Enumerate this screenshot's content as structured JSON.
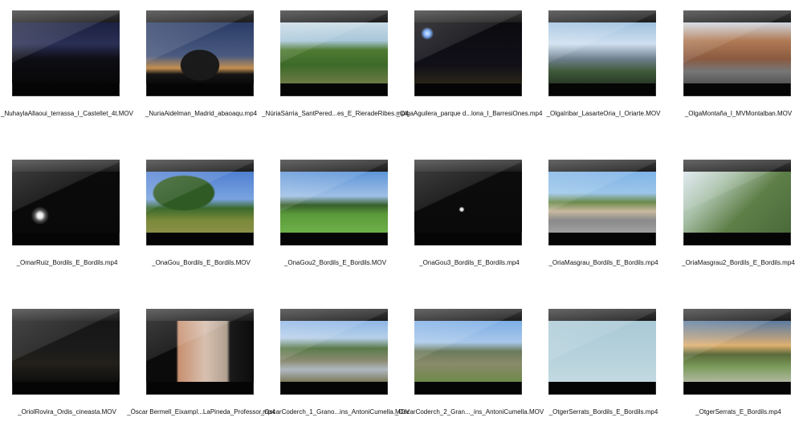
{
  "files": [
    {
      "name": "_NuhaylaAllaoui_terrassa_I_Castellet_4t.MOV",
      "thumb": "night-city"
    },
    {
      "name": "_NuriaAidelman_Madrid_abaoaqu.mp4",
      "thumb": "dusk-tree"
    },
    {
      "name": "_NúriaSàrria_SantPered...es_E_RieradeRibes.mp4",
      "thumb": "green-path"
    },
    {
      "name": "_OlgaAguilera_parque d...lona_I_BarresiOnes.mp4",
      "thumb": "night-moon"
    },
    {
      "name": "_OlgaIribar_LasarteOria_I_Oriarte.MOV",
      "thumb": "city-tower"
    },
    {
      "name": "_OlgaMontaña_I_MVMontalban.MOV",
      "thumb": "street-buildings"
    },
    {
      "name": "_OmarRuiz_Bordils_E_Bordils.mp4",
      "thumb": "dark-moon"
    },
    {
      "name": "_OnaGou_Bordils_E_Bordils.MOV",
      "thumb": "field-tree"
    },
    {
      "name": "_OnaGou2_Bordils_E_Bordils.MOV",
      "thumb": "meadow"
    },
    {
      "name": "_OnaGou3_Bordils_E_Bordils.mp4",
      "thumb": "dark-small-moon"
    },
    {
      "name": "_OriaMasgrau_Bordils_E_Bordils.mp4",
      "thumb": "road-palms"
    },
    {
      "name": "_OriaMasgrau2_Bordils_E_Bordils.mp4",
      "thumb": "hazy-trees"
    },
    {
      "name": "_OriolRovira_Ordis_cineasta.MOV",
      "thumb": "dark-field"
    },
    {
      "name": "_Òscar Bermell_Eixampl...LaPineda_Professor.mp4",
      "thumb": "window-view"
    },
    {
      "name": "_OscarCoderch_1_Grano...ins_AntoniCumella.MOV",
      "thumb": "river"
    },
    {
      "name": "_OscarCoderch_2_Gran..._ins_AntoniCumella.MOV",
      "thumb": "construction"
    },
    {
      "name": "_OtgerSerrats_Bordils_E_Bordils.mp4",
      "thumb": "sky-blue"
    },
    {
      "name": "_OtgerSerrats_E_Bordils.mp4",
      "thumb": "sunset"
    }
  ]
}
